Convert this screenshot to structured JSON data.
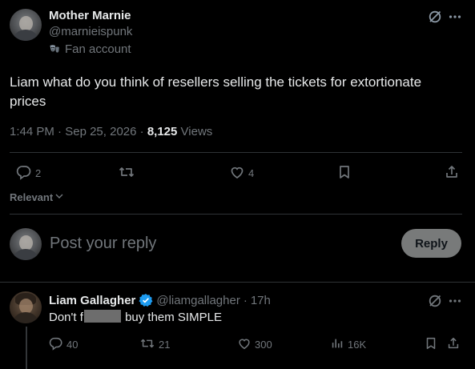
{
  "post": {
    "author_name": "Mother Marnie",
    "author_handle": "@marnieispunk",
    "badge_label": "Fan account",
    "badge_icon": "theater-masks-icon",
    "text": "Liam what do you think of resellers selling the tickets for extortionate prices",
    "time": "1:44 PM",
    "date": "Sep 25, 2026",
    "views_count": "8,125",
    "views_label": "Views",
    "actions": {
      "replies": "2",
      "reposts": "",
      "likes": "4"
    }
  },
  "sort": {
    "label": "Relevant"
  },
  "composer": {
    "placeholder": "Post your reply",
    "reply_button": "Reply"
  },
  "reply": {
    "author_name": "Liam Gallagher",
    "author_handle": "@liamgallagher",
    "age": "17h",
    "text_before": "Don't f",
    "text_after": "buy them SIMPLE",
    "actions": {
      "replies": "40",
      "reposts": "21",
      "likes": "300",
      "views": "16K"
    }
  },
  "colors": {
    "background": "#000000",
    "text": "#e7e9ea",
    "muted": "#71767b",
    "divider": "#2f3336",
    "verified": "#1d9bf0",
    "reply_button_bg": "#787a7a"
  }
}
